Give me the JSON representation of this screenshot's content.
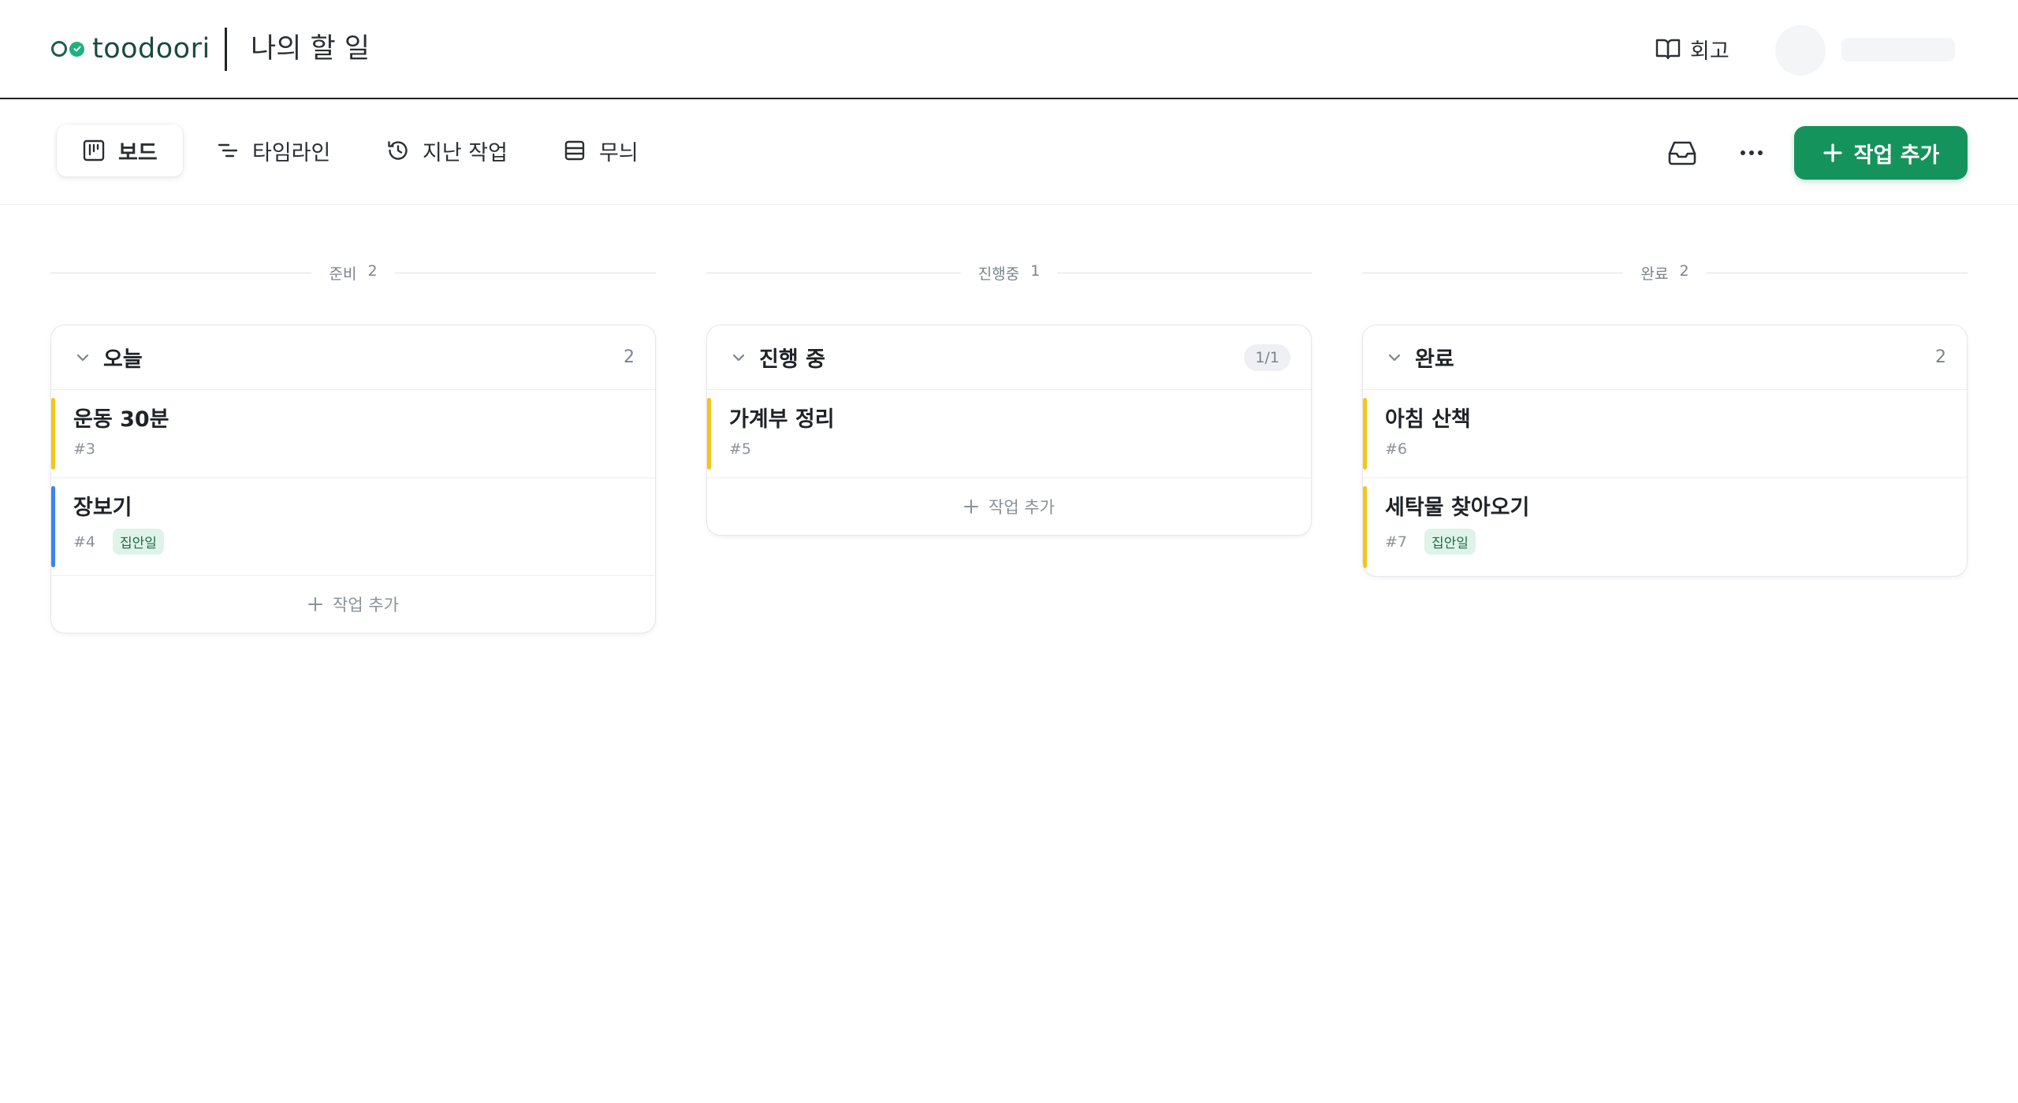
{
  "header": {
    "brand": "toodoori",
    "title": "나의 할 일",
    "retro_label": "회고"
  },
  "toolbar": {
    "tabs": [
      {
        "label": "보드",
        "icon": "board-icon",
        "active": true
      },
      {
        "label": "타임라인",
        "icon": "timeline-icon",
        "active": false
      },
      {
        "label": "지난 작업",
        "icon": "history-icon",
        "active": false
      },
      {
        "label": "무늬",
        "icon": "layout-icon",
        "active": false
      }
    ],
    "add_label": "작업 추가"
  },
  "colors": {
    "accent": "#15935c",
    "bar_yellow": "#f5c518",
    "bar_blue": "#3b82f6",
    "tag_bg": "#dff3e8"
  },
  "columns": [
    {
      "divider_label": "준비",
      "divider_count": "2",
      "title": "오늘",
      "count": "2",
      "tasks": [
        {
          "title": "운동 30분",
          "id": "#3",
          "bar": "yellow"
        },
        {
          "title": "장보기",
          "id": "#4",
          "tag": "집안일",
          "bar": "blue"
        }
      ],
      "add_label": "작업 추가"
    },
    {
      "divider_label": "진행중",
      "divider_count": "1",
      "title": "진행 중",
      "count": "1/1",
      "tasks": [
        {
          "title": "가계부 정리",
          "id": "#5",
          "bar": "yellow"
        }
      ],
      "add_label": "작업 추가"
    },
    {
      "divider_label": "완료",
      "divider_count": "2",
      "title": "완료",
      "count": "2",
      "tasks": [
        {
          "title": "아침 산책",
          "id": "#6",
          "bar": "yellow"
        },
        {
          "title": "세탁물 찾아오기",
          "id": "#7",
          "tag": "집안일",
          "bar": "yellow"
        }
      ]
    }
  ]
}
